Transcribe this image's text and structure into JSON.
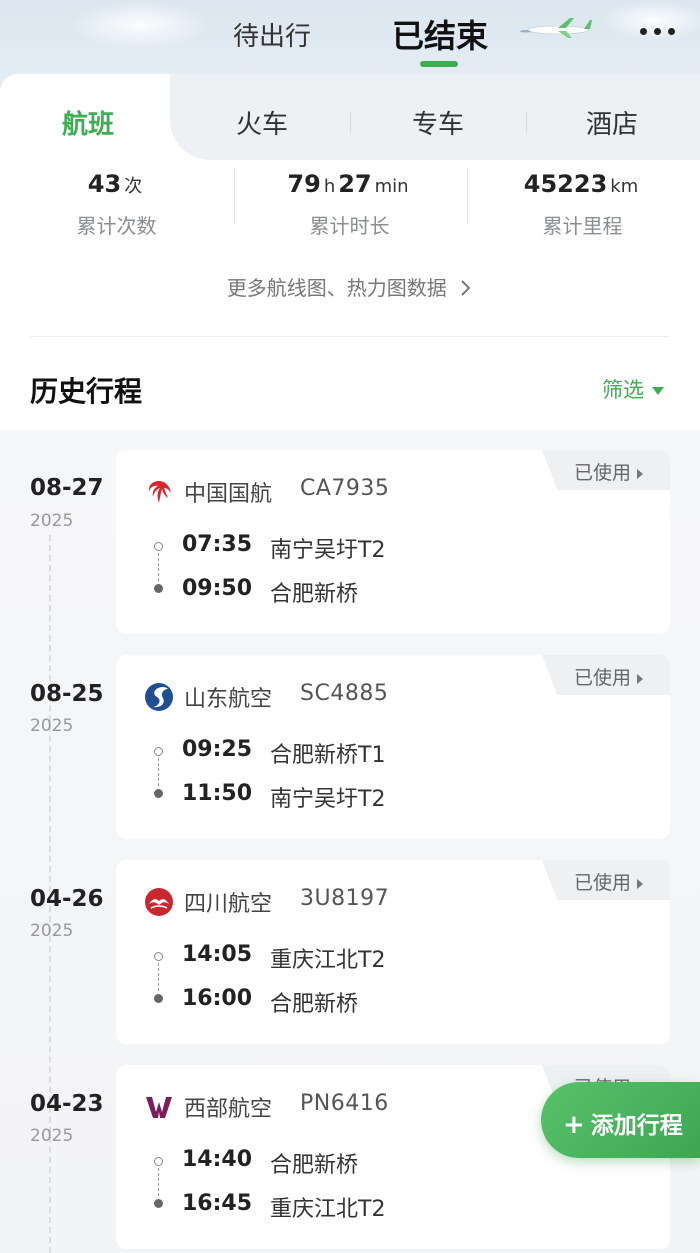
{
  "top_tabs": {
    "pending": "待出行",
    "done": "已结束"
  },
  "category_tabs": [
    "航班",
    "火车",
    "专车",
    "酒店"
  ],
  "stats": [
    {
      "value": "43",
      "unit": "次",
      "label": "累计次数"
    },
    {
      "value": "79",
      "unit": "h",
      "value2": "27",
      "unit2": "min",
      "label": "累计时长"
    },
    {
      "value": "45223",
      "unit": "km",
      "label": "累计里程"
    }
  ],
  "more_data_link": "更多航线图、热力图数据",
  "history": {
    "title": "历史行程",
    "filter": "筛选"
  },
  "trips": [
    {
      "date_md": "08-27",
      "year": "2025",
      "airline": "中国国航",
      "flight_no": "CA7935",
      "logo": "air-china-logo",
      "dep_time": "07:35",
      "dep_airport": "南宁吴圩T2",
      "arr_time": "09:50",
      "arr_airport": "合肥新桥",
      "status": "已使用"
    },
    {
      "date_md": "08-25",
      "year": "2025",
      "airline": "山东航空",
      "flight_no": "SC4885",
      "logo": "shandong-airlines-logo",
      "dep_time": "09:25",
      "dep_airport": "合肥新桥T1",
      "arr_time": "11:50",
      "arr_airport": "南宁吴圩T2",
      "status": "已使用"
    },
    {
      "date_md": "04-26",
      "year": "2025",
      "airline": "四川航空",
      "flight_no": "3U8197",
      "logo": "sichuan-airlines-logo",
      "dep_time": "14:05",
      "dep_airport": "重庆江北T2",
      "arr_time": "16:00",
      "arr_airport": "合肥新桥",
      "status": "已使用"
    },
    {
      "date_md": "04-23",
      "year": "2025",
      "airline": "西部航空",
      "flight_no": "PN6416",
      "logo": "west-air-logo",
      "dep_time": "14:40",
      "dep_airport": "合肥新桥",
      "arr_time": "16:45",
      "arr_airport": "重庆江北T2",
      "status": "已使用"
    }
  ],
  "add_button": "添加行程",
  "colors": {
    "accent": "#3fae52",
    "air_china": "#d7262e",
    "shandong": "#1f4f8f",
    "sichuan": "#c8282e",
    "west_air": "#7b1f5c"
  }
}
